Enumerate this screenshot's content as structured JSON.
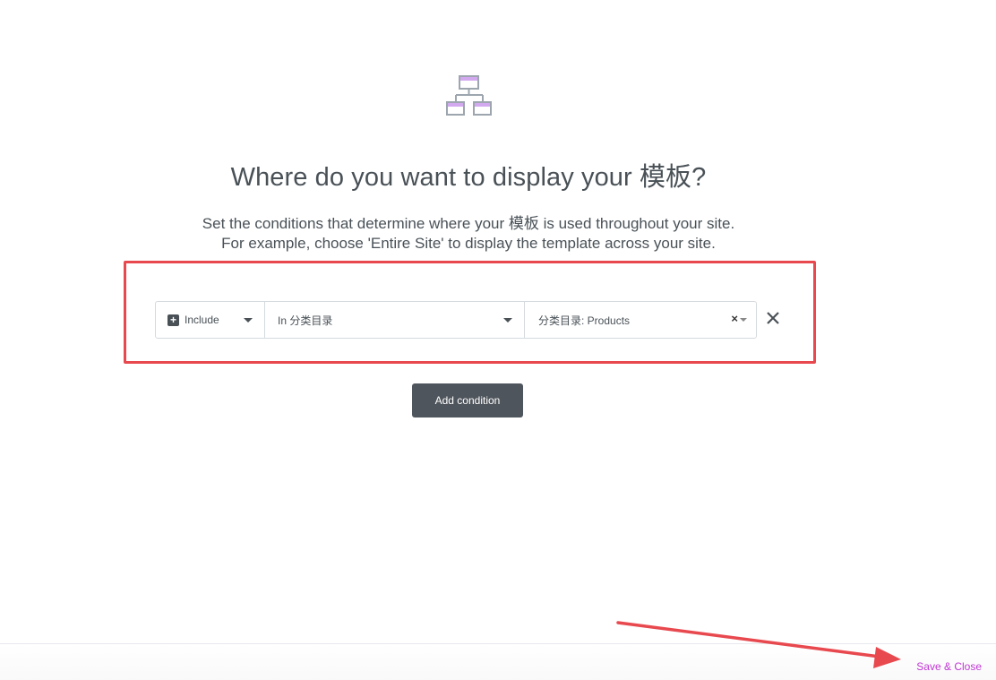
{
  "header": {
    "icon": "site-structure-icon",
    "title": "Where do you want to display your 模板?",
    "description_line1": "Set the conditions that determine where your 模板 is used throughout your site.",
    "description_line2": "For example, choose 'Entire Site' to display the template across your site."
  },
  "condition": {
    "type_icon": "plus-square-icon",
    "type_value": "Include",
    "name_value": "In 分类目录",
    "sub_value": "分类目录: Products",
    "clear_icon": "clear-x-icon",
    "remove_icon": "close-icon"
  },
  "actions": {
    "add_condition_label": "Add condition",
    "save_close_label": "Save & Close"
  },
  "colors": {
    "highlight": "#e8494f",
    "button_bg": "#4f555c",
    "accent_link": "#c036d3",
    "icon_purple": "#d2a8ef",
    "icon_gray": "#9da5ae"
  }
}
